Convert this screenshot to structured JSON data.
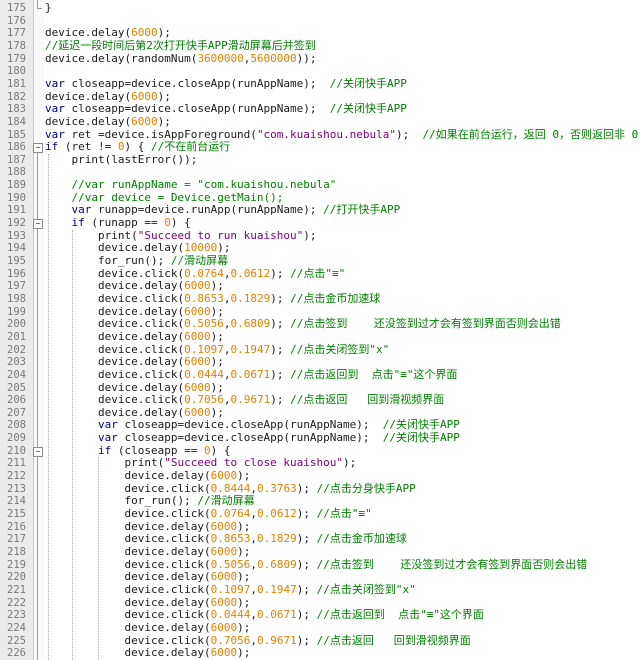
{
  "editor": {
    "lines": [
      {
        "n": "175",
        "t": "}"
      },
      {
        "n": "176",
        "t": ""
      },
      {
        "n": "177",
        "t": "device.delay(6000);"
      },
      {
        "n": "178",
        "t": "//延迟一段时间后第2次打开快手APP滑动屏幕后并签到"
      },
      {
        "n": "179",
        "t": "device.delay(randomNum(3600000,5600000));"
      },
      {
        "n": "180",
        "t": ""
      },
      {
        "n": "181",
        "t": "var closeapp=device.closeApp(runAppName);  //关闭快手APP"
      },
      {
        "n": "182",
        "t": "device.delay(6000);"
      },
      {
        "n": "183",
        "t": "var closeapp=device.closeApp(runAppName);  //关闭快手APP"
      },
      {
        "n": "184",
        "t": "device.delay(6000);"
      },
      {
        "n": "185",
        "t": "var ret =device.isAppForeground(\"com.kuaishou.nebula\");  //如果在前台运行，返回 0，否则返回非 0"
      },
      {
        "n": "186",
        "t": "if (ret != 0) { //不在前台运行"
      },
      {
        "n": "187",
        "t": "    print(lastError());"
      },
      {
        "n": "188",
        "t": ""
      },
      {
        "n": "189",
        "t": "    //var runAppName = \"com.kuaishou.nebula\""
      },
      {
        "n": "190",
        "t": "    //var device = Device.getMain();"
      },
      {
        "n": "191",
        "t": "    var runapp=device.runApp(runAppName); //打开快手APP"
      },
      {
        "n": "192",
        "t": "    if (runapp == 0) {"
      },
      {
        "n": "193",
        "t": "        print(\"Succeed to run kuaishou\");"
      },
      {
        "n": "194",
        "t": "        device.delay(10000);"
      },
      {
        "n": "195",
        "t": "        for_run(); //滑动屏幕"
      },
      {
        "n": "196",
        "t": "        device.click(0.0764,0.0612); //点击\"≡\""
      },
      {
        "n": "197",
        "t": "        device.delay(6000);"
      },
      {
        "n": "198",
        "t": "        device.click(0.8653,0.1829); //点击金币加速球"
      },
      {
        "n": "199",
        "t": "        device.delay(6000);"
      },
      {
        "n": "200",
        "t": "        device.click(0.5056,0.6809); //点击签到    还没签到过才会有签到界面否则会出错"
      },
      {
        "n": "201",
        "t": "        device.delay(6000);"
      },
      {
        "n": "202",
        "t": "        device.click(0.1097,0.1947); //点击关闭签到\"x\""
      },
      {
        "n": "203",
        "t": "        device.delay(6000);"
      },
      {
        "n": "204",
        "t": "        device.click(0.0444,0.0671); //点击返回到  点击\"≡\"这个界面"
      },
      {
        "n": "205",
        "t": "        device.delay(6000);"
      },
      {
        "n": "206",
        "t": "        device.click(0.7056,0.9671); //点击返回   回到滑视频界面"
      },
      {
        "n": "207",
        "t": "        device.delay(6000);"
      },
      {
        "n": "208",
        "t": "        var closeapp=device.closeApp(runAppName);  //关闭快手APP"
      },
      {
        "n": "209",
        "t": "        var closeapp=device.closeApp(runAppName);  //关闭快手APP"
      },
      {
        "n": "210",
        "t": "        if (closeapp == 0) {"
      },
      {
        "n": "211",
        "t": "            print(\"Succeed to close kuaishou\");"
      },
      {
        "n": "212",
        "t": "            device.delay(6000);"
      },
      {
        "n": "213",
        "t": "            device.click(0.8444,0.3763); //点击分身快手APP"
      },
      {
        "n": "214",
        "t": "            for_run(); //滑动屏幕"
      },
      {
        "n": "215",
        "t": "            device.click(0.0764,0.0612); //点击\"≡\""
      },
      {
        "n": "216",
        "t": "            device.delay(6000);"
      },
      {
        "n": "217",
        "t": "            device.click(0.8653,0.1829); //点击金币加速球"
      },
      {
        "n": "218",
        "t": "            device.delay(6000);"
      },
      {
        "n": "219",
        "t": "            device.click(0.5056,0.6809); //点击签到    还没签到过才会有签到界面否则会出错"
      },
      {
        "n": "220",
        "t": "            device.delay(6000);"
      },
      {
        "n": "221",
        "t": "            device.click(0.1097,0.1947); //点击关闭签到\"x\""
      },
      {
        "n": "222",
        "t": "            device.delay(6000);"
      },
      {
        "n": "223",
        "t": "            device.click(0.0444,0.0671); //点击返回到  点击\"≡\"这个界面"
      },
      {
        "n": "224",
        "t": "            device.delay(6000);"
      },
      {
        "n": "225",
        "t": "            device.click(0.7056,0.9671); //点击返回   回到滑视频界面"
      },
      {
        "n": "226",
        "t": "            device.delay(6000);"
      }
    ]
  }
}
